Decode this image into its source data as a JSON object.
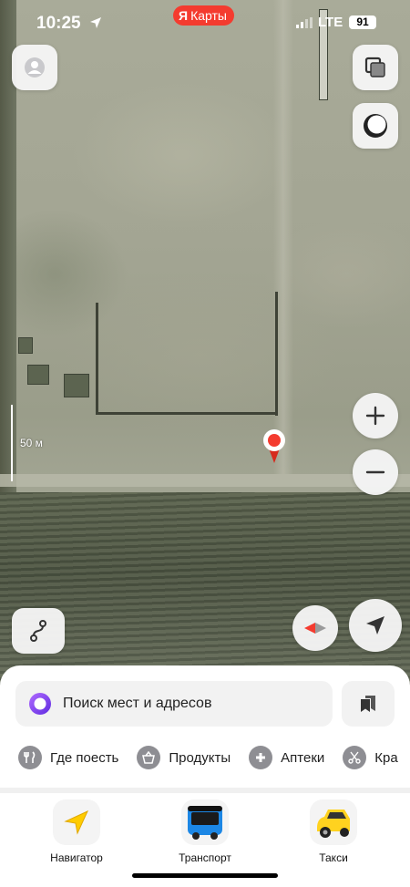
{
  "status_bar": {
    "time": "10:25",
    "app_badge": {
      "logo": "Я",
      "label": "Карты"
    },
    "network": "LTE",
    "battery": "91"
  },
  "map": {
    "scale_label": "50 м"
  },
  "search": {
    "placeholder": "Поиск мест и адресов"
  },
  "categories": [
    {
      "label": "Где поесть",
      "icon": "fork-knife-icon"
    },
    {
      "label": "Продукты",
      "icon": "basket-icon"
    },
    {
      "label": "Аптеки",
      "icon": "pharmacy-cross-icon"
    },
    {
      "label": "Кра",
      "icon": "scissors-icon"
    }
  ],
  "tabs": [
    {
      "label": "Навигатор",
      "icon": "navigator-arrow-icon"
    },
    {
      "label": "Транспорт",
      "icon": "bus-icon"
    },
    {
      "label": "Такси",
      "icon": "taxi-car-icon"
    }
  ],
  "colors": {
    "brand_red": "#f43b2f",
    "alice_purple": "#8a3ffc",
    "taxi_yellow": "#ffd21f",
    "bus_blue": "#1c87e5"
  }
}
